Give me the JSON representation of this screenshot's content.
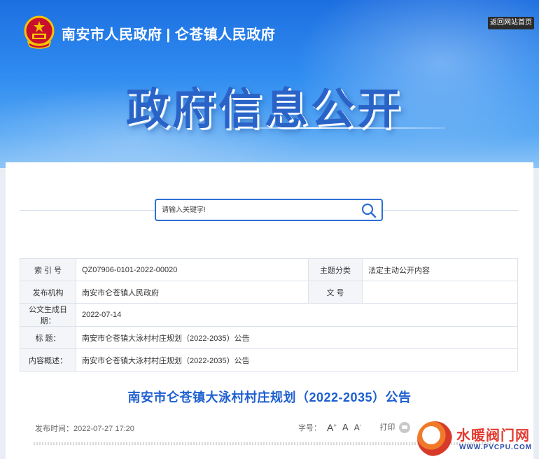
{
  "header": {
    "site_name": "南安市人民政府 | 仑苍镇人民政府",
    "back_home": "返回网站首页",
    "banner_title": "政府信息公开"
  },
  "search": {
    "placeholder": "请输入关键字!"
  },
  "meta": {
    "index_label": "索 引 号",
    "index_value": "QZ07906-0101-2022-00020",
    "topic_label": "主题分类",
    "topic_value": "法定主动公开内容",
    "publisher_label": "发布机构",
    "publisher_value": "南安市仑苍镇人民政府",
    "docno_label": "文 号",
    "docno_value": "",
    "date_label": "公文生成日期：",
    "date_value": "2022-07-14",
    "title_label": "标 题：",
    "title_value": "南安市仑苍镇大泳村村庄规划（2022-2035）公告",
    "summary_label": "内容概述：",
    "summary_value": "南安市仑苍镇大泳村村庄规划（2022-2035）公告"
  },
  "article": {
    "title": "南安市仑苍镇大泳村村庄规划（2022-2035）公告",
    "publish_time": "发布时间：2022-07-27 17:20",
    "font_label": "字号：",
    "font_large": "A",
    "font_medium": "A",
    "font_small": "A",
    "print_label": "打印"
  },
  "watermark": {
    "text": "水暖阀门网",
    "url": "WWW.PVCPU.COM"
  },
  "colors": {
    "brand_blue": "#1d5fd0",
    "banner_blue": "#2f8cf0",
    "watermark_red": "#e43a2f"
  }
}
